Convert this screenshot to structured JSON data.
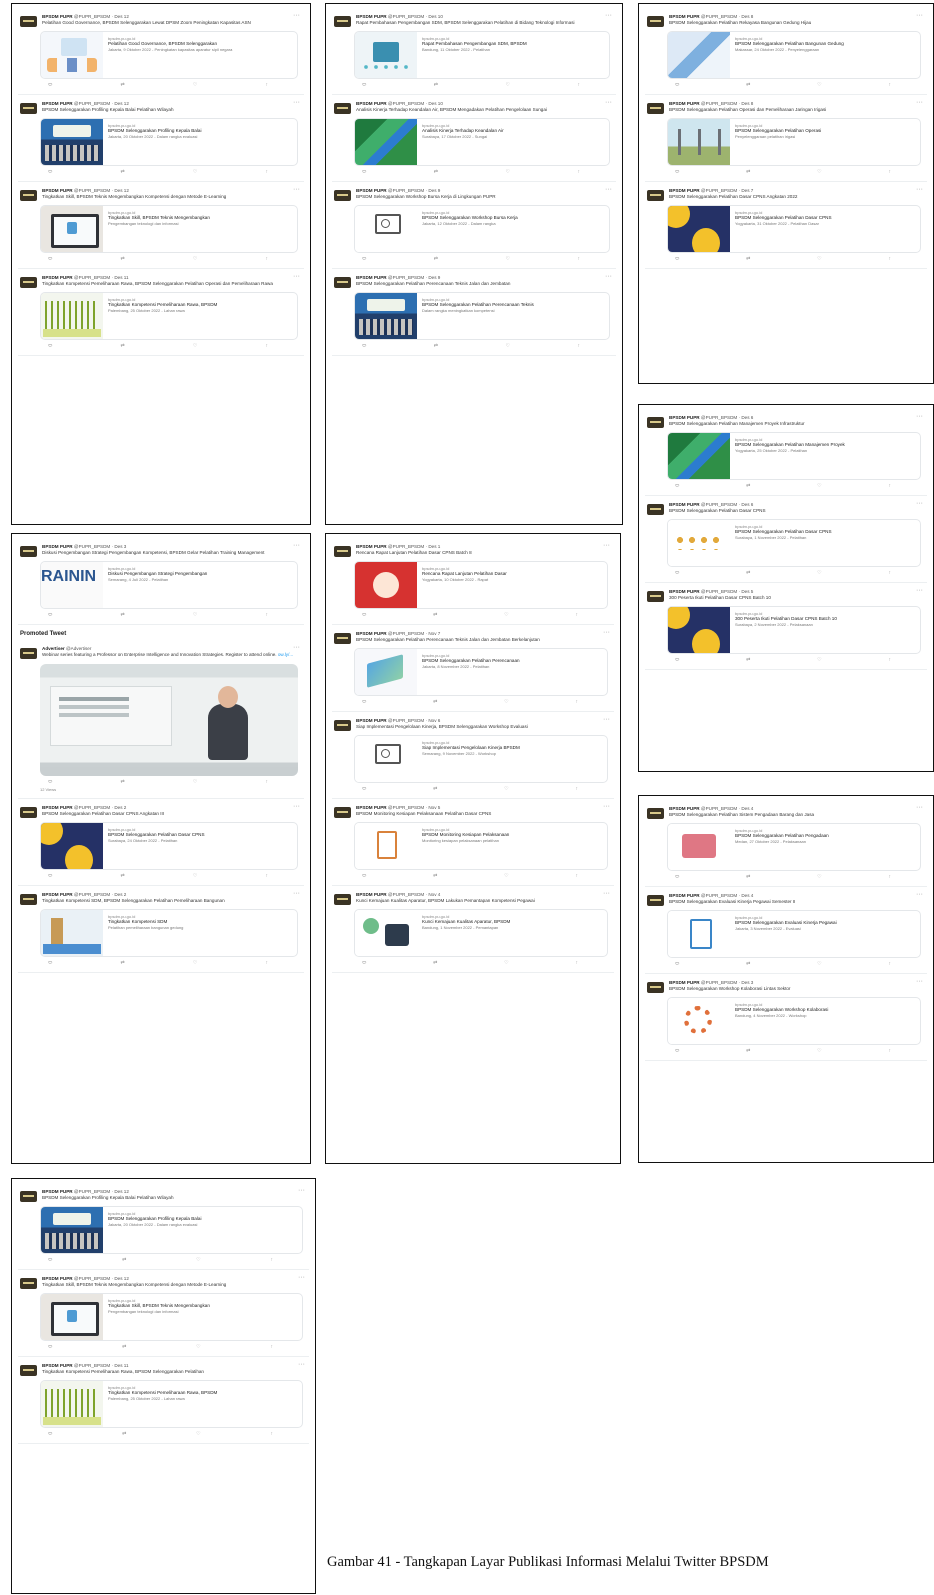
{
  "caption": "Gambar 41 - Tangkapan Layar Publikasi Informasi Melalui Twitter BPSDM",
  "promoted_label": "Promoted Tweet",
  "promoted_link": "ow.ly/...",
  "views_label": "12 Views",
  "panels": [
    {
      "tweets": [
        {
          "account": "BPSDM PUPR",
          "handle": "@PUPR_BPSDM",
          "date": "Des 12",
          "text": "Pelatihan Good Governance, BPSDM Selenggarakan Lewat DPSM Zoom Peningkatan Kapasitas ASN",
          "card_domain": "bpsdm.pu.go.id",
          "card_title": "Pelatihan Good Governance, BPSDM Selenggarakan",
          "card_desc": "Jakarta, 9 Oktober 2022 - Peningkatan kapasitas aparatur sipil negara",
          "thumb": "office"
        },
        {
          "account": "BPSDM PUPR",
          "handle": "@PUPR_BPSDM",
          "date": "Des 12",
          "text": "BPSDM Selenggarakan Profiling Kepala Balai Pelatihan Wilayah",
          "card_domain": "bpsdm.pu.go.id",
          "card_title": "BPSDM Selenggarakan Profiling Kepala Balai",
          "card_desc": "Jakarta, 20 Oktober 2022 - Dalam rangka evaluasi",
          "thumb": "team"
        },
        {
          "account": "BPSDM PUPR",
          "handle": "@PUPR_BPSDM",
          "date": "Des 12",
          "text": "Tingkatkan Skill, BPSDM Teknis Mengembangkan Kompetensi dengan Metode E-Learning",
          "card_domain": "bpsdm.pu.go.id",
          "card_title": "Tingkatkan Skill, BPSDM Teknis Mengembangkan",
          "card_desc": "Pengembangan teknologi dan informasi",
          "thumb": "laptop"
        },
        {
          "account": "BPSDM PUPR",
          "handle": "@PUPR_BPSDM",
          "date": "Des 11",
          "text": "Tingkatkan Kompetensi Pemeliharaan Rawa, BPSDM Selenggarakan Pelatihan Operasi dan Pemeliharaan Rawa",
          "card_domain": "bpsdm.pu.go.id",
          "card_title": "Tingkatkan Kompetensi Pemeliharaan Rawa, BPSDM",
          "card_desc": "Palembang, 25 Oktober 2022 - Lahan rawa",
          "thumb": "grass"
        }
      ]
    },
    {
      "tweets": [
        {
          "account": "BPSDM PUPR",
          "handle": "@PUPR_BPSDM",
          "date": "Des 10",
          "text": "Rapat Pembahasan Pengembangan SDM, BPSDM Selenggarakan Pelatihan di Bidang Teknologi Informasi",
          "card_domain": "bpsdm.pu.go.id",
          "card_title": "Rapat Pembahasan Pengembangan SDM, BPSDM",
          "card_desc": "Bandung, 11 Oktober 2022 - Pelatihan",
          "thumb": "tech"
        },
        {
          "account": "BPSDM PUPR",
          "handle": "@PUPR_BPSDM",
          "date": "Des 10",
          "text": "Analisis Kinerja Terhadap Keandalan Air, BPSDM Mengadakan Pelatihan Pengelolaan Sungai",
          "card_domain": "bpsdm.pu.go.id",
          "card_title": "Analisis Kinerja Terhadap Keandalan Air",
          "card_desc": "Surabaya, 17 Oktober 2022 - Sungai",
          "thumb": "river"
        },
        {
          "account": "BPSDM PUPR",
          "handle": "@PUPR_BPSDM",
          "date": "Des 9",
          "text": "BPSDM Selenggarakan Workshop Bursa Kerja di Lingkungan PUPR",
          "card_domain": "bpsdm.pu.go.id",
          "card_title": "BPSDM Selenggarakan Workshop Bursa Kerja",
          "card_desc": "Jakarta, 12 Oktober 2022 - Dalam rangka",
          "thumb": "icon"
        },
        {
          "account": "BPSDM PUPR",
          "handle": "@PUPR_BPSDM",
          "date": "Des 9",
          "text": "BPSDM Selenggarakan Pelatihan Perencanaan Teknis Jalan dan Jembatan",
          "card_domain": "bpsdm.pu.go.id",
          "card_title": "BPSDM Selenggarakan Pelatihan Perencanaan Teknis",
          "card_desc": "Dalam rangka meningkatkan kompetensi",
          "thumb": "team"
        }
      ]
    },
    {
      "tweets": [
        {
          "account": "BPSDM PUPR",
          "handle": "@PUPR_BPSDM",
          "date": "Des 8",
          "text": "BPSDM Selenggarakan Pelatihan Rekayasa Bangunan Gedung Hijau",
          "card_domain": "bpsdm.pu.go.id",
          "card_title": "BPSDM Selenggarakan Pelatihan Bangunan Gedung",
          "card_desc": "Makassar, 24 Oktober 2022 - Penyelenggaraan",
          "thumb": "glass"
        },
        {
          "account": "BPSDM PUPR",
          "handle": "@PUPR_BPSDM",
          "date": "Des 8",
          "text": "BPSDM Selenggarakan Pelatihan Operasi dan Pemeliharaan Jaringan Irigasi",
          "card_domain": "bpsdm.pu.go.id",
          "card_title": "BPSDM Selenggarakan Pelatihan Operasi",
          "card_desc": "Penyelenggaraan pelatihan irigasi",
          "thumb": "towers"
        },
        {
          "account": "BPSDM PUPR",
          "handle": "@PUPR_BPSDM",
          "date": "Des 7",
          "text": "BPSDM Selenggarakan Pelatihan Dasar CPNS Angkatan 2022",
          "card_domain": "bpsdm.pu.go.id",
          "card_title": "BPSDM Selenggarakan Pelatihan Dasar CPNS",
          "card_desc": "Yogyakarta, 31 Oktober 2022 - Pelatihan Dasar",
          "thumb": "yellow"
        }
      ]
    },
    {
      "tweets": [
        {
          "account": "BPSDM PUPR",
          "handle": "@PUPR_BPSDM",
          "date": "Des 6",
          "text": "BPSDM Selenggarakan Pelatihan Manajemen Proyek Infrastruktur",
          "card_domain": "bpsdm.pu.go.id",
          "card_title": "BPSDM Selenggarakan Pelatihan Manajemen Proyek",
          "card_desc": "Yogyakarta, 25 Oktober 2022 - Pelatihan",
          "thumb": "river"
        },
        {
          "account": "BPSDM PUPR",
          "handle": "@PUPR_BPSDM",
          "date": "Des 6",
          "text": "BPSDM Selenggarakan Pelatihan Dasar CPNS",
          "card_domain": "bpsdm.pu.go.id",
          "card_title": "BPSDM Selenggarakan Pelatihan Dasar CPNS",
          "card_desc": "Surabaya, 1 November 2022 - Pelatihan",
          "thumb": "cogs"
        },
        {
          "account": "BPSDM PUPR",
          "handle": "@PUPR_BPSDM",
          "date": "Des 5",
          "text": "300 Peserta Ikuti Pelatihan Dasar CPNS Batch 10",
          "card_domain": "bpsdm.pu.go.id",
          "card_title": "300 Peserta Ikuti Pelatihan Dasar CPNS Batch 10",
          "card_desc": "Surabaya, 2 November 2022 - Pelaksanaan",
          "thumb": "yellow"
        }
      ]
    },
    {
      "tweets": [
        {
          "account": "BPSDM PUPR",
          "handle": "@PUPR_BPSDM",
          "date": "Des 4",
          "text": "BPSDM Selenggarakan Pelatihan Sistem Pengadaan Barang dan Jasa",
          "card_domain": "bpsdm.pu.go.id",
          "card_title": "BPSDM Selenggarakan Pelatihan Pengadaan",
          "card_desc": "Medan, 27 Oktober 2022 - Pelaksanaan",
          "thumb": "meeting"
        },
        {
          "account": "BPSDM PUPR",
          "handle": "@PUPR_BPSDM",
          "date": "Des 4",
          "text": "BPSDM Selenggarakan Evaluasi Kinerja Pegawai Semester II",
          "card_domain": "bpsdm.pu.go.id",
          "card_title": "BPSDM Selenggarakan Evaluasi Kinerja Pegawai",
          "card_desc": "Jakarta, 3 November 2022 - Evaluasi",
          "thumb": "clip"
        },
        {
          "account": "BPSDM PUPR",
          "handle": "@PUPR_BPSDM",
          "date": "Des 3",
          "text": "BPSDM Selenggarakan Workshop Kolaborasi Lintas Sektor",
          "card_domain": "bpsdm.pu.go.id",
          "card_title": "BPSDM Selenggarakan Workshop Kolaborasi",
          "card_desc": "Bandung, 4 November 2022 - Workshop",
          "thumb": "ring"
        }
      ]
    },
    {
      "tweets_before": [
        {
          "account": "BPSDM PUPR",
          "handle": "@PUPR_BPSDM",
          "date": "Des 3",
          "text": "Diskusi Pengembangan Strategi Pengembangan Kompetensi, BPSDM Gelar Pelatihan Training Management",
          "card_domain": "bpsdm.pu.go.id",
          "card_title": "Diskusi Pengembangan Strategi Pengembangan",
          "card_desc": "Semarang, 4 Juli 2022 - Pelatihan",
          "thumb": "rain"
        }
      ],
      "promoted": {
        "account": "Advertiser",
        "handle": "@Advertiser",
        "text": "Webinar series featuring a Professor on Enterprise Intelligence and Innovation Strategies. Register to attend online."
      },
      "tweets_after": [
        {
          "account": "BPSDM PUPR",
          "handle": "@PUPR_BPSDM",
          "date": "Des 2",
          "text": "BPSDM Selenggarakan Pelatihan Dasar CPNS Angkatan III",
          "card_domain": "bpsdm.pu.go.id",
          "card_title": "BPSDM Selenggarakan Pelatihan Dasar CPNS",
          "card_desc": "Surabaya, 24 Oktober 2022 - Pelatihan",
          "thumb": "yellow"
        },
        {
          "account": "BPSDM PUPR",
          "handle": "@PUPR_BPSDM",
          "date": "Des 2",
          "text": "Tingkatkan Kompetensi SDM, BPSDM Selenggarakan Pelatihan Pemeliharaan Bangunan",
          "card_domain": "bpsdm.pu.go.id",
          "card_title": "Tingkatkan Kompetensi SDM",
          "card_desc": "Pelatihan pemeliharaan bangunan gedung",
          "thumb": "building"
        }
      ]
    },
    {
      "tweets": [
        {
          "account": "BPSDM PUPR",
          "handle": "@PUPR_BPSDM",
          "date": "Des 1",
          "text": "Rencana Rapat Lanjutan Pelatihan Dasar CPNS Batch 8",
          "card_domain": "bpsdm.pu.go.id",
          "card_title": "Rencana Rapat Lanjutan Pelatihan Dasar",
          "card_desc": "Yogyakarta, 10 Oktober 2022 - Rapat",
          "thumb": "red"
        },
        {
          "account": "BPSDM PUPR",
          "handle": "@PUPR_BPSDM",
          "date": "Nov 7",
          "text": "BPSDM Selenggarakan Pelatihan Perencanaan Teknis Jalan dan Jembatan Berkelanjutan",
          "card_domain": "bpsdm.pu.go.id",
          "card_title": "BPSDM Selenggarakan Pelatihan Perencanaan",
          "card_desc": "Jakarta, 8 November 2022 - Pelatihan",
          "thumb": "iso"
        },
        {
          "account": "BPSDM PUPR",
          "handle": "@PUPR_BPSDM",
          "date": "Nov 6",
          "text": "Siap Implementasi Pengelolaan Kinerja, BPSDM Selenggarakan Workshop Evaluasi",
          "card_domain": "bpsdm.pu.go.id",
          "card_title": "Siap Implementasi Pengelolaan Kinerja BPSDM",
          "card_desc": "Semarang, 9 November 2022 - Workshop",
          "thumb": "icon"
        },
        {
          "account": "BPSDM PUPR",
          "handle": "@PUPR_BPSDM",
          "date": "Nov 5",
          "text": "BPSDM Monitoring Kesiapan Pelaksanaan Pelatihan Dasar CPNS",
          "card_domain": "bpsdm.pu.go.id",
          "card_title": "BPSDM Monitoring Kesiapan Pelaksanaan",
          "card_desc": "Monitoring kesiapan pelaksanaan pelatihan",
          "thumb": "doc"
        },
        {
          "account": "BPSDM PUPR",
          "handle": "@PUPR_BPSDM",
          "date": "Nov 4",
          "text": "Kunci Kemajuan Kualitas Aparatur, BPSDM Lakukan Pemantapan Kompetensi Pegawai",
          "card_domain": "bpsdm.pu.go.id",
          "card_title": "Kunci Kemajuan Kualitas Aparatur, BPSDM",
          "card_desc": "Bandung, 1 November 2022 - Pemantapan",
          "thumb": "people"
        }
      ]
    },
    {
      "tweets": [
        {
          "account": "BPSDM PUPR",
          "handle": "@PUPR_BPSDM",
          "date": "Des 12",
          "text": "BPSDM Selenggarakan Profiling Kepala Balai Pelatihan Wilayah",
          "card_domain": "bpsdm.pu.go.id",
          "card_title": "BPSDM Selenggarakan Profiling Kepala Balai",
          "card_desc": "Jakarta, 20 Oktober 2022 - Dalam rangka evaluasi",
          "thumb": "team"
        },
        {
          "account": "BPSDM PUPR",
          "handle": "@PUPR_BPSDM",
          "date": "Des 12",
          "text": "Tingkatkan Skill, BPSDM Teknis Mengembangkan Kompetensi dengan Metode E-Learning",
          "card_domain": "bpsdm.pu.go.id",
          "card_title": "Tingkatkan Skill, BPSDM Teknis Mengembangkan",
          "card_desc": "Pengembangan teknologi dan informasi",
          "thumb": "laptop"
        },
        {
          "account": "BPSDM PUPR",
          "handle": "@PUPR_BPSDM",
          "date": "Des 11",
          "text": "Tingkatkan Kompetensi Pemeliharaan Rawa, BPSDM Selenggarakan Pelatihan",
          "card_domain": "bpsdm.pu.go.id",
          "card_title": "Tingkatkan Kompetensi Pemeliharaan Rawa, BPSDM",
          "card_desc": "Palembang, 25 Oktober 2022 - Lahan rawa",
          "thumb": "grass"
        }
      ]
    }
  ]
}
